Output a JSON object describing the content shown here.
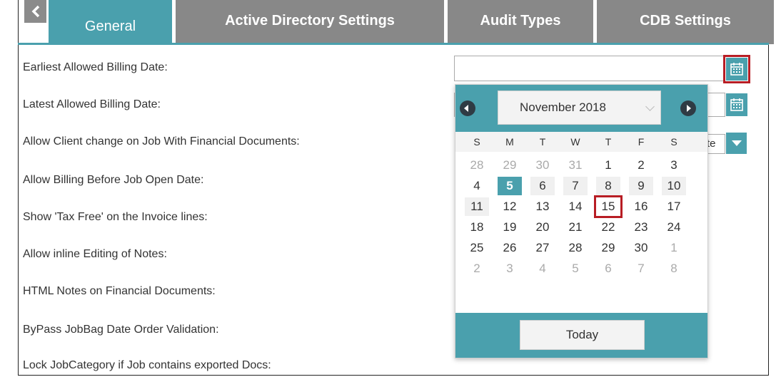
{
  "tabs": {
    "back_icon": "chevron-left-icon",
    "items": [
      {
        "label": "General"
      },
      {
        "label": "Active Directory Settings"
      },
      {
        "label": "Audit Types"
      },
      {
        "label": "CDB Settings"
      }
    ],
    "active_index": 0
  },
  "form": {
    "labels": [
      "Earliest Allowed Billing Date:",
      "Latest Allowed Billing Date:",
      "Allow Client change on Job With Financial Documents:",
      "Allow Billing Before Job Open Date:",
      "Show 'Tax Free' on the Invoice lines:",
      "Allow inline Editing of Notes:",
      "HTML Notes on Financial Documents:",
      "ByPass JobBag Date Order Validation:",
      "Lock JobCategory if Job contains exported Docs:"
    ],
    "earliest_date_value": "",
    "latest_date_value": "",
    "select_partial_text": "te"
  },
  "calendar": {
    "month_label": "November 2018",
    "weekdays": [
      "S",
      "M",
      "T",
      "W",
      "T",
      "F",
      "S"
    ],
    "weeks": [
      [
        "28",
        "29",
        "30",
        "31",
        "1",
        "2",
        "3"
      ],
      [
        "4",
        "5",
        "6",
        "7",
        "8",
        "9",
        "10"
      ],
      [
        "11",
        "12",
        "13",
        "14",
        "15",
        "16",
        "17"
      ],
      [
        "18",
        "19",
        "20",
        "21",
        "22",
        "23",
        "24"
      ],
      [
        "25",
        "26",
        "27",
        "28",
        "29",
        "30",
        "1"
      ],
      [
        "2",
        "3",
        "4",
        "5",
        "6",
        "7",
        "8"
      ]
    ],
    "selected_day": "5",
    "highlighted_day": "15",
    "today_label": "Today"
  },
  "colors": {
    "accent": "#4aa0ad",
    "tab_inactive": "#888888",
    "highlight_red": "#b81d24"
  }
}
